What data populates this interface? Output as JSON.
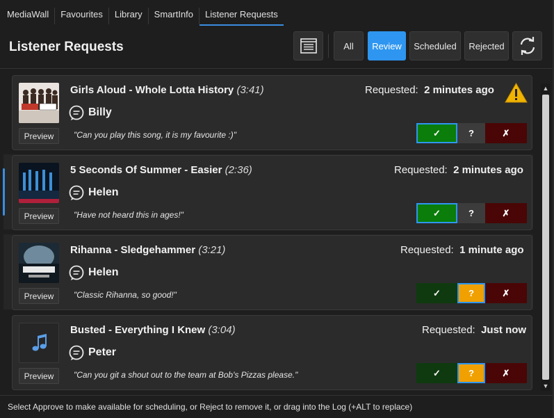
{
  "tabs": [
    {
      "label": "MediaWall",
      "active": false
    },
    {
      "label": "Favourites",
      "active": false
    },
    {
      "label": "Library",
      "active": false
    },
    {
      "label": "SmartInfo",
      "active": false
    },
    {
      "label": "Listener Requests",
      "active": true
    }
  ],
  "header": {
    "title": "Listener Requests",
    "list_icon": "list-icon",
    "filters": {
      "all": "All",
      "review": "Review",
      "scheduled": "Scheduled",
      "rejected": "Rejected"
    },
    "active_filter": "Review",
    "refresh_icon": "refresh-icon"
  },
  "requests": [
    {
      "title": "Girls Aloud - Whole Lotta History",
      "duration": "(3:41)",
      "requested_label": "Requested:",
      "requested_time": "2 minutes ago",
      "user": "Billy",
      "message": "\"Can you play this song, it is my favourite :)\"",
      "preview_label": "Preview",
      "approve_label": "✓",
      "hold_label": "?",
      "reject_label": "✗",
      "state": "approved",
      "warning": true
    },
    {
      "title": "5 Seconds Of Summer - Easier",
      "duration": "(2:36)",
      "requested_label": "Requested:",
      "requested_time": "2 minutes ago",
      "user": "Helen",
      "message": "\"Have not heard this in ages!\"",
      "preview_label": "Preview",
      "approve_label": "✓",
      "hold_label": "?",
      "reject_label": "✗",
      "state": "approved",
      "warning": false
    },
    {
      "title": "Rihanna - Sledgehammer",
      "duration": "(3:21)",
      "requested_label": "Requested:",
      "requested_time": "1 minute ago",
      "user": "Helen",
      "message": "\"Classic Rihanna, so good!\"",
      "preview_label": "Preview",
      "approve_label": "✓",
      "hold_label": "?",
      "reject_label": "✗",
      "state": "review",
      "warning": false
    },
    {
      "title": "Busted - Everything I Knew",
      "duration": "(3:04)",
      "requested_label": "Requested:",
      "requested_time": "Just now",
      "user": "Peter",
      "message": "\"Can you git a shout out to the team at Bob's Pizzas please.\"",
      "preview_label": "Preview",
      "approve_label": "✓",
      "hold_label": "?",
      "reject_label": "✗",
      "state": "review",
      "warning": false
    }
  ],
  "footer": {
    "hint": "Select Approve to make available for scheduling, or Reject to remove it, or drag into the Log (+ALT to replace)"
  },
  "colors": {
    "accent": "#2e96f0",
    "approve_on": "#0a7d0a",
    "hold_on": "#f0a000",
    "reject": "#4a0606",
    "warning": "#f0b400"
  }
}
